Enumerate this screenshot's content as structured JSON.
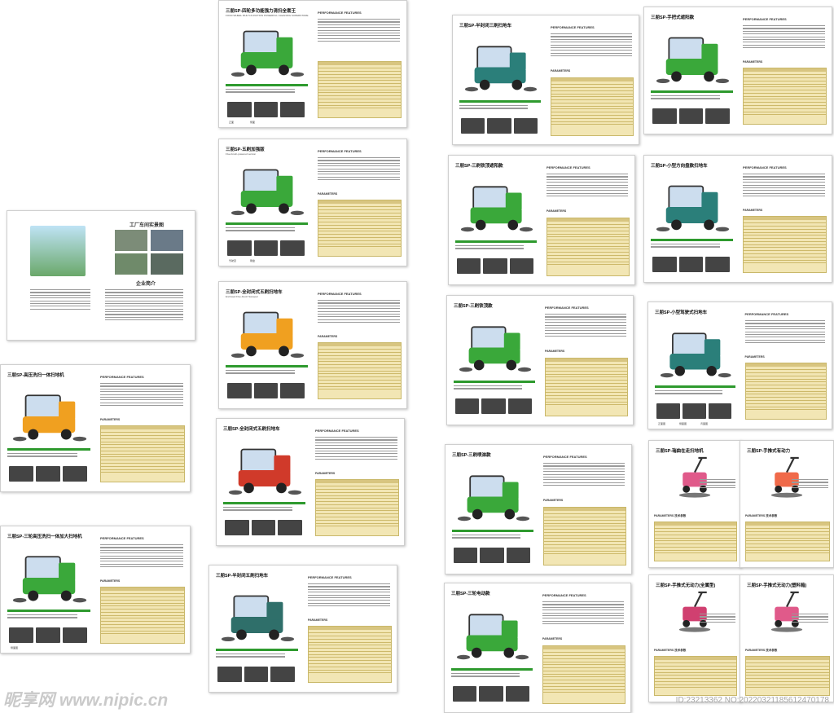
{
  "catalog": {
    "intro_page": {
      "heading": "工厂车间实景图",
      "company_heading": "企业简介"
    },
    "pages": [
      {
        "id": "p1",
        "title": "三朋SP-四轮多功能强力清扫全套王",
        "subtitle": "FOUR-WHEEL MULTI-FUNCTION POWERFUL CLEANING SUPERSTORE",
        "features_label": "PERFORMANCE FEATURES",
        "params_label": "",
        "caps": [
          "正面",
          "侧面"
        ],
        "accent": "#2e9a2e",
        "body": "#3aa83a"
      },
      {
        "id": "p2",
        "title": "三朋SP-五刷加强版",
        "subtitle": "Five-brush-powered version",
        "features_label": "PERFORMANCE FEATURES",
        "params_label": "PARAMETERS",
        "caps": [
          "驾驶室",
          "刷盘"
        ],
        "accent": "#2e9a2e",
        "body": "#3aa83a"
      },
      {
        "id": "p3",
        "title": "三朋SP-全封闭式五刷扫地车",
        "subtitle": "Enclosed Five-brush Sweeper",
        "features_label": "PERFORMANCE FEATURES",
        "params_label": "PARAMETERS",
        "caps": [],
        "accent": "#2e9a2e",
        "body": "#f0a020"
      },
      {
        "id": "p4",
        "title": "三朋SP-全封闭式五刷扫地车",
        "subtitle": "",
        "features_label": "PERFORMANCE FEATURES",
        "params_label": "PARAMETERS",
        "caps": [],
        "accent": "#2e9a2e",
        "body": "#d03a2a"
      },
      {
        "id": "p5",
        "title": "三朋SP-半封闭五刷扫地车",
        "subtitle": "",
        "features_label": "PERFORMANCE FEATURES",
        "params_label": "PARAMETERS",
        "caps": [],
        "accent": "#2e9a2e",
        "body": "#2f6f6a"
      },
      {
        "id": "p6",
        "title": "三朋SP-半封闭三刷扫地车",
        "subtitle": "",
        "features_label": "PERFORMANCE FEATURES",
        "params_label": "PARAMETERS",
        "caps": [],
        "accent": "#2e9a2e",
        "body": "#2b7f7a"
      },
      {
        "id": "p7",
        "title": "三朋SP-三刷铁顶遮阳款",
        "subtitle": "",
        "features_label": "PERFORMANCE FEATURES",
        "params_label": "PARAMETERS",
        "caps": [],
        "accent": "#2e9a2e",
        "body": "#3aa83a"
      },
      {
        "id": "p8",
        "title": "三朋SP-三刷铁顶款",
        "subtitle": "",
        "features_label": "PERFORMANCE FEATURES",
        "params_label": "PARAMETERS",
        "caps": [],
        "accent": "#2e9a2e",
        "body": "#3aa83a"
      },
      {
        "id": "p9",
        "title": "三朋SP-三刷喷淋款",
        "subtitle": "",
        "features_label": "PERFORMANCE FEATURES",
        "params_label": "PARAMETERS",
        "caps": [],
        "accent": "#2e9a2e",
        "body": "#3aa83a"
      },
      {
        "id": "p10",
        "title": "三朋SP-三轮电动款",
        "subtitle": "",
        "features_label": "PERFORMANCE FEATURES",
        "params_label": "PARAMETERS",
        "caps": [],
        "accent": "#2e9a2e",
        "body": "#3aa83a"
      },
      {
        "id": "p11",
        "title": "三朋SP-手把式遮阳款",
        "subtitle": "",
        "features_label": "PERFORMANCE FEATURES",
        "params_label": "PARAMETERS",
        "caps": [],
        "accent": "#2e9a2e",
        "body": "#3aa83a"
      },
      {
        "id": "p12",
        "title": "三朋SP-小型方向盘款扫地车",
        "subtitle": "",
        "features_label": "PERFORMANCE FEATURES",
        "params_label": "PARAMETERS",
        "caps": [],
        "accent": "#2e9a2e",
        "body": "#2b7f7a"
      },
      {
        "id": "p13",
        "title": "三朋SP-小型驾驶式扫地车",
        "subtitle": "",
        "features_label": "PERFORMANCE FEATURES",
        "params_label": "PARAMETERS",
        "caps": [
          "正面图",
          "侧面图",
          "背面图"
        ],
        "accent": "#2e9a2e",
        "body": "#2b7f7a"
      },
      {
        "id": "p14",
        "title": "三朋SP-高压洗扫一体扫地机",
        "subtitle": "",
        "features_label": "PERFORMANCE FEATURES",
        "params_label": "PARAMETERS",
        "caps": [],
        "accent": "#2e9a2e",
        "body": "#f0a020"
      },
      {
        "id": "p15",
        "title": "三朋SP-三轮高压洗扫一体加大扫地机",
        "subtitle": "",
        "features_label": "PERFORMANCE FEATURES",
        "params_label": "PARAMETERS",
        "caps": [
          "侧面图"
        ],
        "accent": "#2e9a2e",
        "body": "#3aa83a"
      },
      {
        "id": "p16",
        "title": "三朋SP-瑞曲在走扫地机",
        "subtitle": "",
        "features_label": "",
        "params_label": "PARAMETERS 技术参数",
        "caps": [],
        "accent": "#2e9a2e",
        "body": "#e05a8a"
      },
      {
        "id": "p17",
        "title": "三朋SP-手推式有动力",
        "subtitle": "",
        "features_label": "",
        "params_label": "PARAMETERS 技术参数",
        "caps": [],
        "accent": "#2e9a2e",
        "body": "#f06a4a"
      },
      {
        "id": "p18",
        "title": "三朋SP-手推式无动力(全属型)",
        "subtitle": "",
        "features_label": "",
        "params_label": "PARAMETERS 技术参数",
        "caps": [],
        "accent": "#2e9a2e",
        "body": "#d04070"
      },
      {
        "id": "p19",
        "title": "三朋SP-手推式无动力(塑料箱)",
        "subtitle": "",
        "features_label": "",
        "params_label": "PARAMETERS 技术参数",
        "caps": [],
        "accent": "#2e9a2e",
        "body": "#e05a8a"
      }
    ]
  },
  "watermark": {
    "logo_text": "昵享网 www.nipic.cn",
    "id_text": "ID:23213362 NO:20220321185612470178"
  }
}
